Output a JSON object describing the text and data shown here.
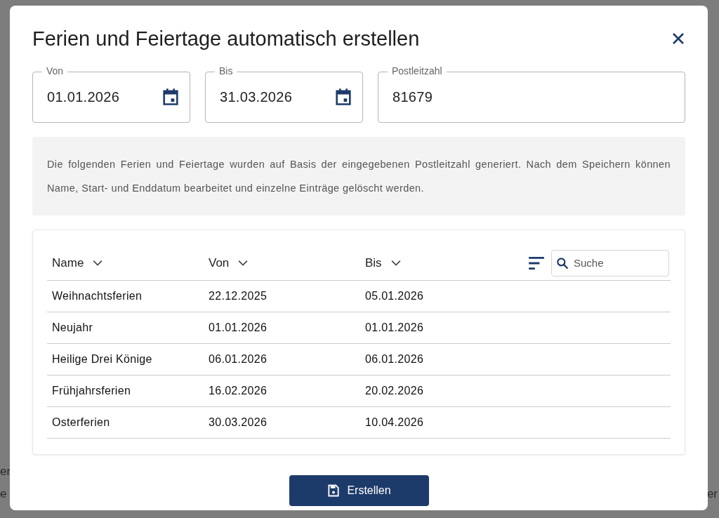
{
  "background_left": [
    "er",
    "e"
  ],
  "background_right": [
    "er"
  ],
  "dialog": {
    "title": "Ferien und Feiertage automatisch erstellen",
    "fields": [
      {
        "kind": "date",
        "label": "Von",
        "value": "01.01.2026"
      },
      {
        "kind": "date",
        "label": "Bis",
        "value": "31.03.2026"
      },
      {
        "kind": "text",
        "label": "Postleitzahl",
        "value": "81679"
      }
    ],
    "info": "Die folgenden Ferien und Feiertage wurden auf Basis der eingegebenen Postleitzahl generiert. Nach dem Speichern können Name, Start- und Enddatum bearbeitet und einzelne Einträge gelöscht werden.",
    "table": {
      "columns": [
        "Name",
        "Von",
        "Bis"
      ],
      "search": {
        "placeholder": "Suche"
      },
      "rows": [
        [
          "Weihnachtsferien",
          "22.12.2025",
          "05.01.2026"
        ],
        [
          "Neujahr",
          "01.01.2026",
          "01.01.2026"
        ],
        [
          "Heilige Drei Könige",
          "06.01.2026",
          "06.01.2026"
        ],
        [
          "Frühjahrsferien",
          "16.02.2026",
          "20.02.2026"
        ],
        [
          "Osterferien",
          "30.03.2026",
          "10.04.2026"
        ]
      ]
    },
    "button": "Erstellen"
  }
}
